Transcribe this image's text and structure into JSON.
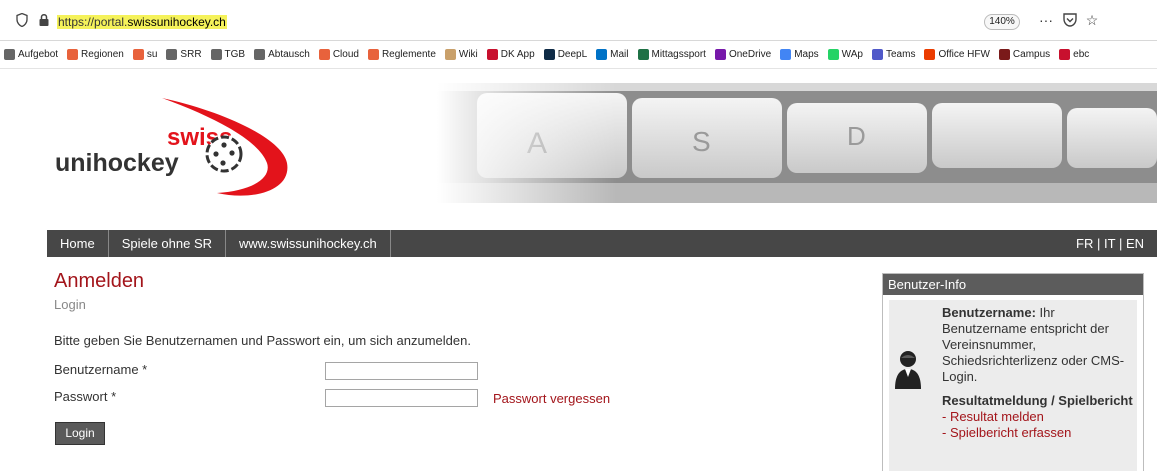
{
  "browser": {
    "url_proto": "https://portal.",
    "url_host": "swissunihockey.ch",
    "zoom": "140%",
    "icons": [
      "shield-icon",
      "lock-icon",
      "more-icon",
      "pocket-icon",
      "star-icon"
    ],
    "bookmarks": [
      {
        "label": "Aufgebot",
        "color": "#666666"
      },
      {
        "label": "Regionen",
        "color": "#e8623c"
      },
      {
        "label": "su",
        "color": "#e8623c"
      },
      {
        "label": "SRR",
        "color": "#666666"
      },
      {
        "label": "TGB",
        "color": "#666666"
      },
      {
        "label": "Abtausch",
        "color": "#666666"
      },
      {
        "label": "Cloud",
        "color": "#e8623c"
      },
      {
        "label": "Reglemente",
        "color": "#e8623c"
      },
      {
        "label": "Wiki",
        "color": "#c9a06a"
      },
      {
        "label": "DK App",
        "color": "#c8102e"
      },
      {
        "label": "DeepL",
        "color": "#0f2b46"
      },
      {
        "label": "Mail",
        "color": "#0072c6"
      },
      {
        "label": "Mittagssport",
        "color": "#1e7145"
      },
      {
        "label": "OneDrive",
        "color": "#7719aa"
      },
      {
        "label": "Maps",
        "color": "#4285f4"
      },
      {
        "label": "WAp",
        "color": "#25d366"
      },
      {
        "label": "Teams",
        "color": "#5059c9"
      },
      {
        "label": "Office HFW",
        "color": "#eb3c00"
      },
      {
        "label": "Campus",
        "color": "#7a1a1a"
      },
      {
        "label": "ebc",
        "color": "#c8102e"
      }
    ]
  },
  "logo": {
    "line1": "swiss",
    "line2": "unihockey"
  },
  "nav": {
    "items": [
      "Home",
      "Spiele ohne SR",
      "www.swissunihockey.ch"
    ],
    "lang": [
      "FR",
      "IT",
      "EN"
    ]
  },
  "main": {
    "title": "Anmelden",
    "subtitle": "Login",
    "intro": "Bitte geben Sie Benutzernamen und Passwort ein, um sich anzumelden.",
    "username_label": "Benutzername *",
    "password_label": "Passwort *",
    "username_value": "",
    "password_value": "",
    "forgot": "Passwort vergessen",
    "login_button": "Login"
  },
  "sidebar": {
    "title": "Benutzer-Info",
    "username_bold": "Benutzername:",
    "username_text": " Ihr Benutzername entspricht der Vereinsnummer, Schiedsrichterlizenz oder CMS-Login.",
    "result_bold": "Resultatmeldung / Spielbericht",
    "links": [
      "- Resultat melden",
      "- Spielbericht erfassen"
    ]
  },
  "colors": {
    "accent": "#a3151b",
    "nav": "#474747",
    "url_highlight": "#f5f25a"
  }
}
